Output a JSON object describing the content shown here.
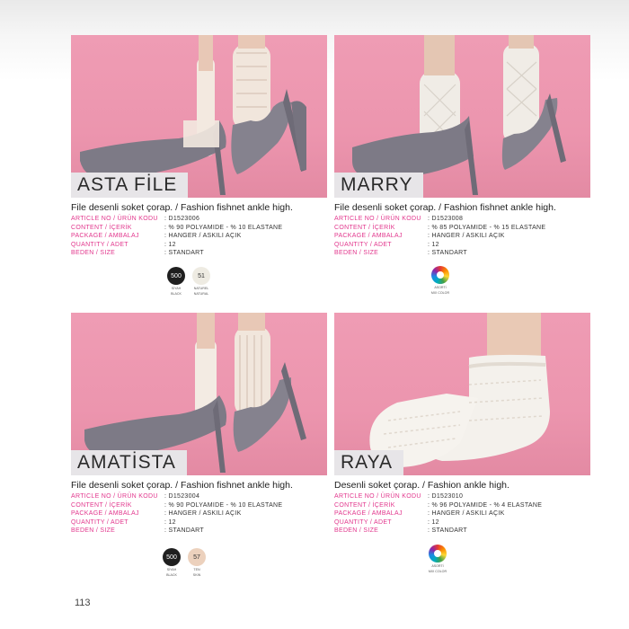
{
  "page_number": "113",
  "spec_keys": {
    "article": "ARTICLE NO / ÜRÜN KODU",
    "content": "CONTENT / İÇERİK",
    "package": "PACKAGE / AMBALAJ",
    "quantity": "QUANTITY / ADET",
    "size": "BEDEN / SIZE"
  },
  "products": [
    {
      "name": "ASTA FİLE",
      "description": "File desenli soket çorap. / Fashion fishnet ankle high.",
      "article": ": D1523006",
      "content": ": % 90 POLYAMIDE - % 10 ELASTANE",
      "package": ": HANGER / ASKILI AÇIK",
      "quantity": ": 12",
      "size": ": STANDART",
      "colors": [
        {
          "code": "500",
          "label1": "SİYAH",
          "label2": "BLACK",
          "hex": "#1f1f1f",
          "text_color": "#ffffff"
        },
        {
          "code": "51",
          "label1": "NATUREL",
          "label2": "NATURAL",
          "hex": "#eeebe2",
          "text_color": "#333333"
        }
      ]
    },
    {
      "name": "MARRY",
      "description": "File desenli soket çorap. / Fashion fishnet ankle high.",
      "article": ": D1523008",
      "content": ": % 85 POLYAMIDE - % 15 ELASTANE",
      "package": ": HANGER / ASKILI AÇIK",
      "quantity": ": 12",
      "size": ": STANDART",
      "colors": [
        {
          "code": "",
          "label1": "ASORTİ",
          "label2": "MIX COLOR",
          "hex": "multi",
          "text_color": "#333333"
        }
      ]
    },
    {
      "name": "AMATİSTA",
      "description": "File desenli soket çorap. / Fashion fishnet ankle high.",
      "article": ": D1523004",
      "content": ": % 90 POLYAMIDE - % 10 ELASTANE",
      "package": ": HANGER / ASKILI AÇIK",
      "quantity": ": 12",
      "size": ": STANDART",
      "colors": [
        {
          "code": "500",
          "label1": "SİYAH",
          "label2": "BLACK",
          "hex": "#1f1f1f",
          "text_color": "#ffffff"
        },
        {
          "code": "57",
          "label1": "TEN",
          "label2": "SKIN",
          "hex": "#ecd1bd",
          "text_color": "#333333"
        }
      ]
    },
    {
      "name": "RAYA",
      "description": "Desenli soket çorap. / Fashion ankle high.",
      "article": ": D1523010",
      "content": ": % 96 POLYAMIDE - % 4 ELASTANE",
      "package": ": HANGER / ASKILI AÇIK",
      "quantity": ": 12",
      "size": ": STANDART",
      "colors": [
        {
          "code": "",
          "label1": "ASORTİ",
          "label2": "MIX COLOR",
          "hex": "multi",
          "text_color": "#333333"
        }
      ]
    }
  ]
}
